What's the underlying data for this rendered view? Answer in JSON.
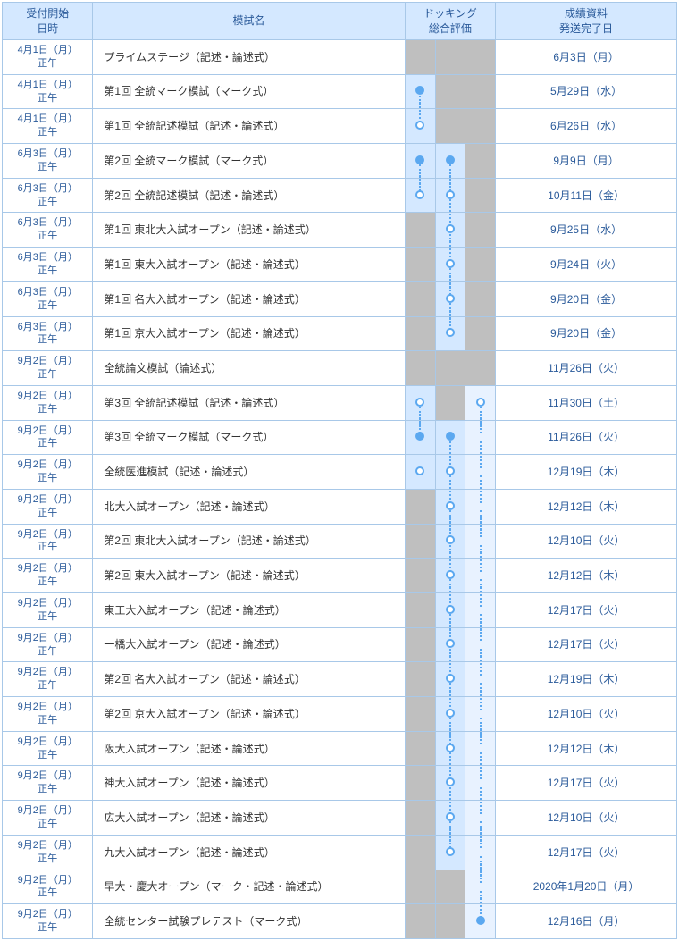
{
  "headers": {
    "date": "受付開始\n日時",
    "name": "模試名",
    "dock": "ドッキング\n総合評価",
    "ship": "成績資料\n発送完了日"
  },
  "rows": [
    {
      "date": "4月1日（月）\n正午",
      "name": "プライムステージ（記述・論述式）",
      "d1": "gray",
      "d2": "gray",
      "d3": "gray",
      "ship": "6月3日（月）"
    },
    {
      "date": "4月1日（月）\n正午",
      "name": "第1回 全統マーク模試（マーク式）",
      "d1": "blue filled first1",
      "d2": "gray",
      "d3": "gray",
      "ship": "5月29日（水）"
    },
    {
      "date": "4月1日（月）\n正午",
      "name": "第1回 全統記述模試（記述・論述式）",
      "d1": "blue open last1",
      "d2": "gray",
      "d3": "gray",
      "ship": "6月26日（水）"
    },
    {
      "date": "6月3日（月）\n正午",
      "name": "第2回 全統マーク模試（マーク式）",
      "d1": "blue filled first1",
      "d2": "blue filled first2",
      "d3": "gray",
      "ship": "9月9日（月）"
    },
    {
      "date": "6月3日（月）\n正午",
      "name": "第2回 全統記述模試（記述・論述式）",
      "d1": "blue open last1",
      "d2": "blue open mid2",
      "d3": "gray",
      "ship": "10月11日（金）"
    },
    {
      "date": "6月3日（月）\n正午",
      "name": "第1回 東北大入試オープン（記述・論述式）",
      "d1": "gray",
      "d2": "blue open mid2",
      "d3": "gray",
      "ship": "9月25日（水）"
    },
    {
      "date": "6月3日（月）\n正午",
      "name": "第1回 東大入試オープン（記述・論述式）",
      "d1": "gray",
      "d2": "blue open mid2",
      "d3": "gray",
      "ship": "9月24日（火）"
    },
    {
      "date": "6月3日（月）\n正午",
      "name": "第1回 名大入試オープン（記述・論述式）",
      "d1": "gray",
      "d2": "blue open mid2",
      "d3": "gray",
      "ship": "9月20日（金）"
    },
    {
      "date": "6月3日（月）\n正午",
      "name": "第1回 京大入試オープン（記述・論述式）",
      "d1": "gray",
      "d2": "blue open last2",
      "d3": "gray",
      "ship": "9月20日（金）"
    },
    {
      "date": "9月2日（月）\n正午",
      "name": "全統論文模試（論述式）",
      "d1": "gray",
      "d2": "gray",
      "d3": "gray",
      "ship": "11月26日（火）"
    },
    {
      "date": "9月2日（月）\n正午",
      "name": "第3回 全統記述模試（記述・論述式）",
      "d1": "blue open first1",
      "d2": "gray",
      "d3": "blue2 open first3",
      "ship": "11月30日（土）"
    },
    {
      "date": "9月2日（月）\n正午",
      "name": "第3回 全統マーク模試（マーク式）",
      "d1": "blue filled last1",
      "d2": "blue filled first2",
      "d3": "blue2 line3",
      "ship": "11月26日（火）"
    },
    {
      "date": "9月2日（月）\n正午",
      "name": "全統医進模試（記述・論述式）",
      "d1": "blue open alone",
      "d2": "blue open mid2",
      "d3": "blue2 line3",
      "ship": "12月19日（木）"
    },
    {
      "date": "9月2日（月）\n正午",
      "name": "北大入試オープン（記述・論述式）",
      "d1": "gray",
      "d2": "blue open mid2",
      "d3": "blue2 line3",
      "ship": "12月12日（木）"
    },
    {
      "date": "9月2日（月）\n正午",
      "name": "第2回 東北大入試オープン（記述・論述式）",
      "d1": "gray",
      "d2": "blue open mid2",
      "d3": "blue2 line3",
      "ship": "12月10日（火）"
    },
    {
      "date": "9月2日（月）\n正午",
      "name": "第2回 東大入試オープン（記述・論述式）",
      "d1": "gray",
      "d2": "blue open mid2",
      "d3": "blue2 line3",
      "ship": "12月12日（木）"
    },
    {
      "date": "9月2日（月）\n正午",
      "name": "東工大入試オープン（記述・論述式）",
      "d1": "gray",
      "d2": "blue open mid2",
      "d3": "blue2 line3",
      "ship": "12月17日（火）"
    },
    {
      "date": "9月2日（月）\n正午",
      "name": "一橋大入試オープン（記述・論述式）",
      "d1": "gray",
      "d2": "blue open mid2",
      "d3": "blue2 line3",
      "ship": "12月17日（火）"
    },
    {
      "date": "9月2日（月）\n正午",
      "name": "第2回 名大入試オープン（記述・論述式）",
      "d1": "gray",
      "d2": "blue open mid2",
      "d3": "blue2 line3",
      "ship": "12月19日（木）"
    },
    {
      "date": "9月2日（月）\n正午",
      "name": "第2回 京大入試オープン（記述・論述式）",
      "d1": "gray",
      "d2": "blue open mid2",
      "d3": "blue2 line3",
      "ship": "12月10日（火）"
    },
    {
      "date": "9月2日（月）\n正午",
      "name": "阪大入試オープン（記述・論述式）",
      "d1": "gray",
      "d2": "blue open mid2",
      "d3": "blue2 line3",
      "ship": "12月12日（木）"
    },
    {
      "date": "9月2日（月）\n正午",
      "name": "神大入試オープン（記述・論述式）",
      "d1": "gray",
      "d2": "blue open mid2",
      "d3": "blue2 line3",
      "ship": "12月17日（火）"
    },
    {
      "date": "9月2日（月）\n正午",
      "name": "広大入試オープン（記述・論述式）",
      "d1": "gray",
      "d2": "blue open mid2",
      "d3": "blue2 line3",
      "ship": "12月10日（火）"
    },
    {
      "date": "9月2日（月）\n正午",
      "name": "九大入試オープン（記述・論述式）",
      "d1": "gray",
      "d2": "blue open last2",
      "d3": "blue2 line3",
      "ship": "12月17日（火）"
    },
    {
      "date": "9月2日（月）\n正午",
      "name": "早大・慶大オープン（マーク・記述・論述式）",
      "d1": "gray",
      "d2": "gray",
      "d3": "blue2 line3",
      "ship": "2020年1月20日（月）"
    },
    {
      "date": "9月2日（月）\n正午",
      "name": "全統センター試験プレテスト（マーク式）",
      "d1": "gray",
      "d2": "gray",
      "d3": "blue2 filled last3",
      "ship": "12月16日（月）"
    }
  ]
}
